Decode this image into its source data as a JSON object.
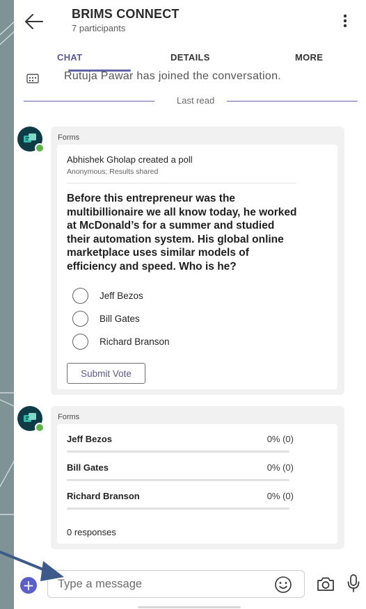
{
  "header": {
    "title": "BRIMS CONNECT",
    "subtitle": "7 participants",
    "tabs": [
      "CHAT",
      "DETAILS",
      "MORE"
    ],
    "active_tab": "CHAT"
  },
  "system_message": {
    "text": "Rutuja Pawar has joined the conversation."
  },
  "last_read_label": "Last read",
  "poll_message": {
    "sender": "Forms",
    "creator_line": "Abhishek Gholap created a poll",
    "meta": "Anonymous; Results shared",
    "question": "Before this entrepreneur was the multibillionaire we all know today, he worked at McDonald’s for a summer and studied their automation system. His global online marketplace uses similar models of efficiency and speed. Who is he?",
    "options": [
      "Jeff Bezos",
      "Bill Gates",
      "Richard Branson"
    ],
    "submit_label": "Submit Vote"
  },
  "results_message": {
    "sender": "Forms",
    "rows": [
      {
        "name": "Jeff Bezos",
        "value": "0% (0)",
        "fraction": 0
      },
      {
        "name": "Bill Gates",
        "value": "0% (0)",
        "fraction": 0
      },
      {
        "name": "Richard Branson",
        "value": "0% (0)",
        "fraction": 0
      }
    ],
    "responses": "0 responses"
  },
  "compose": {
    "placeholder": "Type a message",
    "icons": [
      "plus-icon",
      "emoji-icon",
      "camera-icon",
      "microphone-icon"
    ]
  },
  "colors": {
    "accent": "#6264a7",
    "avatar_bg": "#0e3b45",
    "presence": "#5fb34b",
    "bubble": "#f1f1f1"
  }
}
